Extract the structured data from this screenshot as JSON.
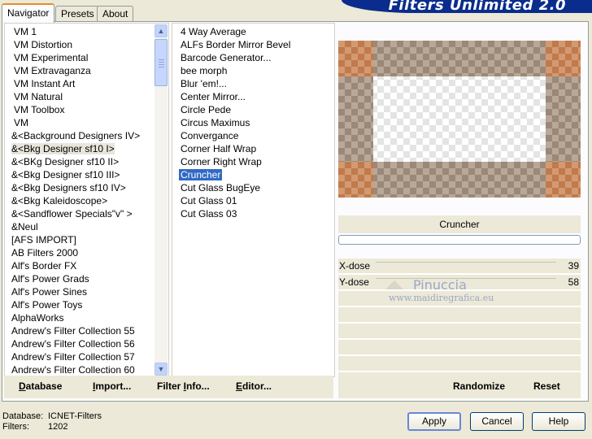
{
  "tabs": [
    {
      "label": "Navigator",
      "active": true
    },
    {
      "label": "Presets",
      "active": false
    },
    {
      "label": "About",
      "active": false
    }
  ],
  "title": "Filters Unlimited 2.0",
  "categories": [
    "VM 1",
    "VM Distortion",
    "VM Experimental",
    "VM Extravaganza",
    "VM Instant Art",
    "VM Natural",
    "VM Toolbox",
    "VM",
    "&<Background Designers IV>",
    "&<Bkg Designer sf10 I>",
    "&<BKg Designer sf10 II>",
    "&<Bkg Designer sf10 III>",
    "&<Bkg Designers sf10 IV>",
    "&<Bkg Kaleidoscope>",
    "&<Sandflower Specials\"v\" >",
    "&Neul",
    "[AFS IMPORT]",
    "AB Filters 2000",
    "Alf's Border FX",
    "Alf's Power Grads",
    "Alf's Power Sines",
    "Alf's Power Toys",
    "AlphaWorks",
    "Andrew's Filter Collection 55",
    "Andrew's Filter Collection 56",
    "Andrew's Filter Collection 57",
    "Andrew's Filter Collection 60"
  ],
  "selected_category": "&<Bkg Designer sf10 I>",
  "filters": [
    "4 Way Average",
    "ALFs Border Mirror Bevel",
    "Barcode Generator...",
    "bee morph",
    "Blur 'em!...",
    "Center Mirror...",
    "Circle Pede",
    "Circus Maximus",
    "Convergance",
    "Corner Half Wrap",
    "Corner Right Wrap",
    "Cruncher",
    "Cut Glass  BugEye",
    "Cut Glass 01",
    "Cut Glass 03"
  ],
  "selected_filter": "Cruncher",
  "filter_name": "Cruncher",
  "params": [
    {
      "name": "X-dose",
      "value": "39"
    },
    {
      "name": "Y-dose",
      "value": "58"
    }
  ],
  "watermark": {
    "line1": "Pinuccia",
    "line2": "www.maidiregrafica.eu"
  },
  "left_buttons": {
    "database": {
      "u": "D",
      "rest": "atabase"
    },
    "import": {
      "u": "I",
      "rest": "mport..."
    },
    "filter_info": {
      "pre": "Filter ",
      "u": "I",
      "rest": "nfo..."
    },
    "editor": {
      "u": "E",
      "rest": "ditor..."
    }
  },
  "right_buttons": {
    "randomize": "Randomize",
    "reset": "Reset"
  },
  "status": {
    "database_label": "Database:",
    "database_value": "ICNET-Filters",
    "filters_label": "Filters:",
    "filters_value": "1202"
  },
  "dialog_buttons": {
    "apply": "Apply",
    "cancel": "Cancel",
    "help": "Help"
  },
  "colors": {
    "selection": "#316ac5",
    "accent_tab": "#e68b2c",
    "banner": "#0a2c8c"
  }
}
